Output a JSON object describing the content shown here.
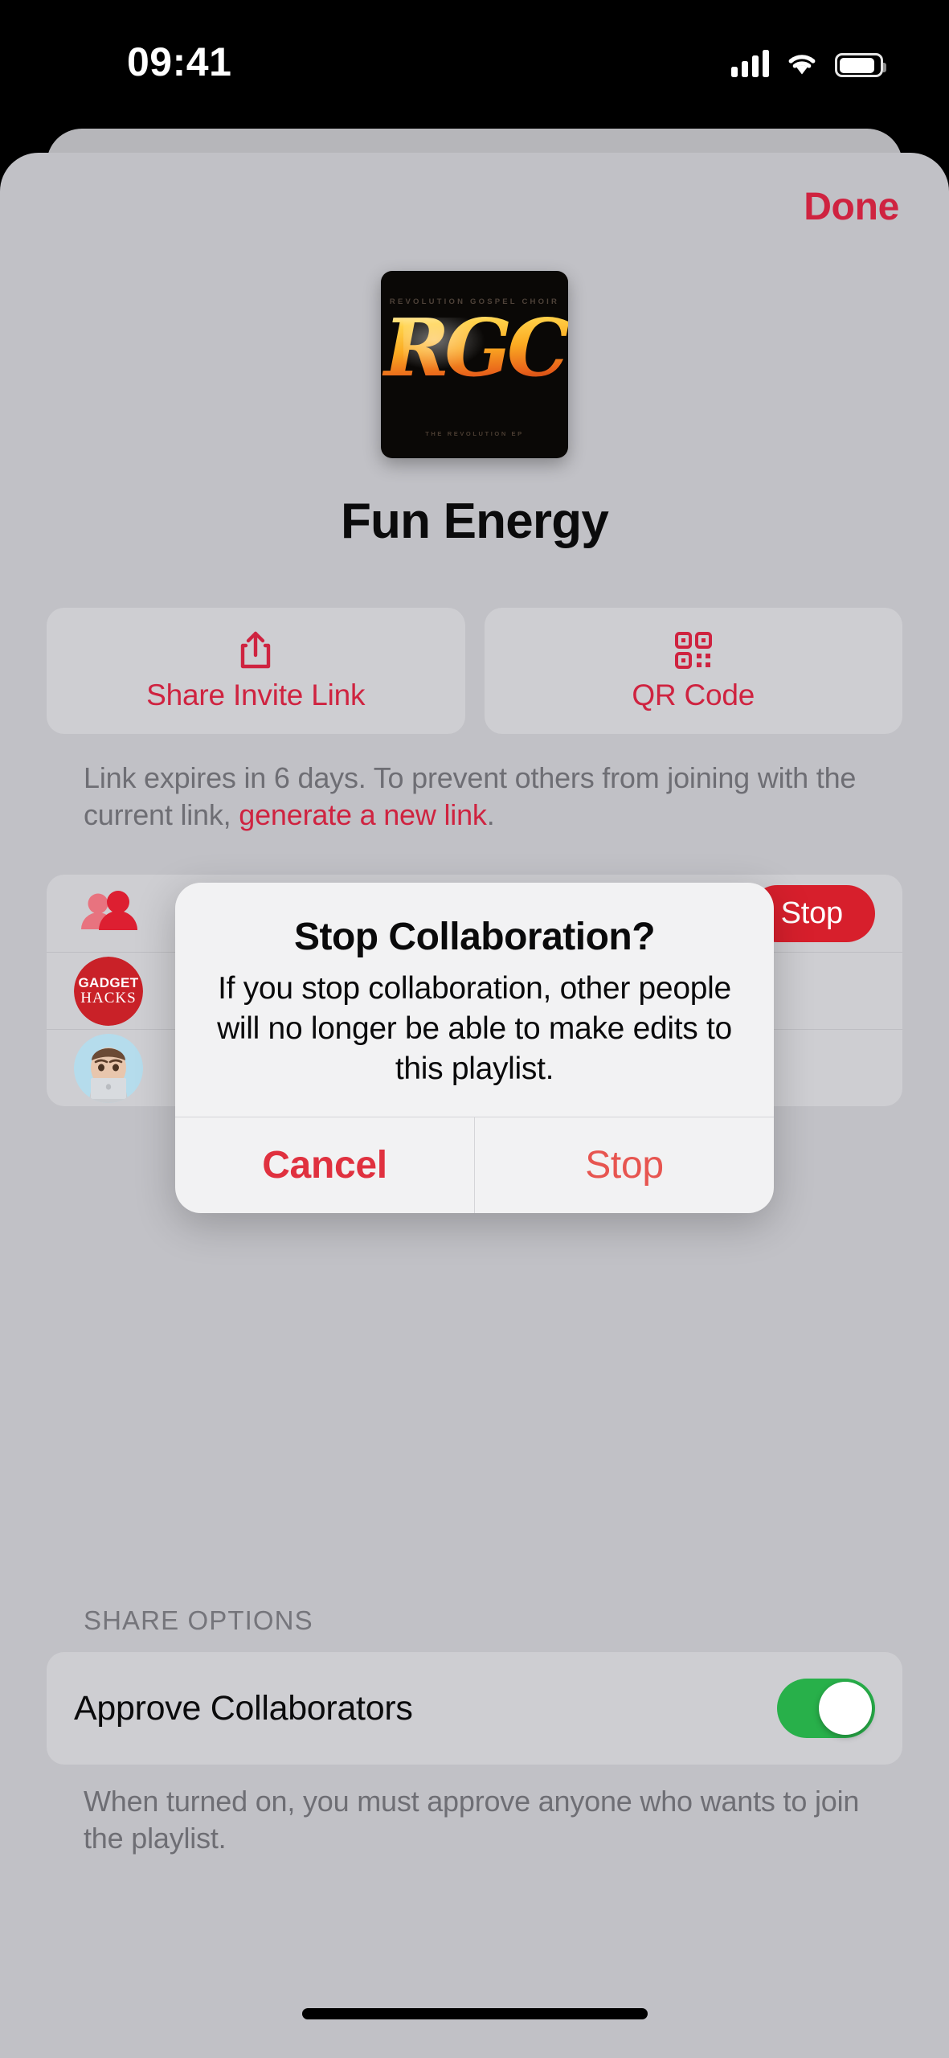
{
  "status_bar": {
    "time": "09:41",
    "cellular_icon": "cellular-signal-icon",
    "wifi_icon": "wifi-icon",
    "battery_icon": "battery-icon"
  },
  "header": {
    "done_label": "Done"
  },
  "playlist": {
    "title": "Fun Energy",
    "artwork": {
      "top_text": "REVOLUTION GOSPEL CHOIR",
      "logo_text": "RGC",
      "bottom_text": "THE REVOLUTION EP"
    }
  },
  "actions": [
    {
      "label": "Share Invite Link",
      "icon": "share-icon"
    },
    {
      "label": "QR Code",
      "icon": "qr-code-icon"
    }
  ],
  "link_caption": {
    "lead": "Link expires in 6 days. To prevent others from joining with the current link, ",
    "link_text": "generate a new link",
    "trail": "."
  },
  "collaborators": [
    {
      "avatar": "two-people-icon",
      "name": "",
      "action": "Stop"
    },
    {
      "avatar": "gadget-hacks-logo",
      "name": "",
      "action": ""
    },
    {
      "avatar": "memoji-avatar",
      "name": "",
      "action": ""
    }
  ],
  "gadget_hacks": {
    "line1": "GADGET",
    "line2": "HACKS"
  },
  "share_options": {
    "header": "SHARE OPTIONS",
    "approve_label": "Approve Collaborators",
    "approve_state": "on",
    "caption": "When turned on, you must approve anyone who wants to join the playlist."
  },
  "alert": {
    "title": "Stop Collaboration?",
    "message": "If you stop collaboration, other people will no longer be able to make edits to this playlist.",
    "cancel_label": "Cancel",
    "confirm_label": "Stop"
  },
  "colors": {
    "accent_red": "#cf2340",
    "alert_red": "#e0313f",
    "toggle_green": "#28b04a",
    "sheet_bg": "#c1c1c6",
    "card_bg": "#ceced2"
  }
}
